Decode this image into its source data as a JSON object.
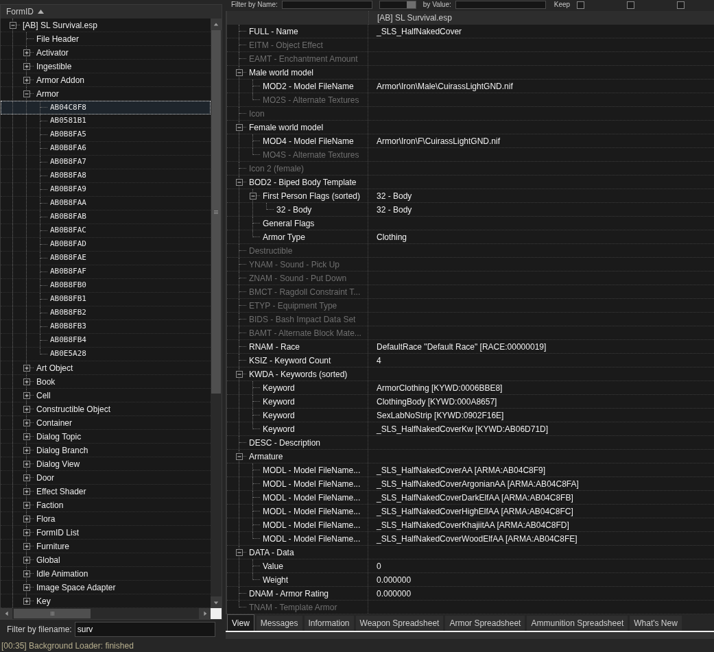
{
  "filter_bar": {
    "name_label": "Filter by Name:",
    "value_label": "by Value:",
    "keep_label": "Keep",
    "checkboxes": [
      {
        "checked": false
      },
      {
        "checked": false
      },
      {
        "checked": false
      }
    ]
  },
  "left_panel": {
    "column_header": "FormID",
    "sort_ascending": true,
    "tree": [
      {
        "label": "[AB] SL Survival.esp",
        "kind": "group",
        "expanded": true,
        "selected": false,
        "children": [
          {
            "label": "File Header",
            "kind": "group",
            "selected": false
          },
          {
            "label": "Activator",
            "kind": "group",
            "expanded": false,
            "selected": false
          },
          {
            "label": "Ingestible",
            "kind": "group",
            "expanded": false,
            "selected": false
          },
          {
            "label": "Armor Addon",
            "kind": "group",
            "expanded": false,
            "selected": false
          },
          {
            "label": "Armor",
            "kind": "group",
            "expanded": true,
            "selected": false,
            "children": [
              {
                "label": "AB04C8F8",
                "kind": "record",
                "selected": true
              },
              {
                "label": "AB0581B1",
                "kind": "record",
                "selected": false
              },
              {
                "label": "AB0B8FA5",
                "kind": "record",
                "selected": false
              },
              {
                "label": "AB0B8FA6",
                "kind": "record",
                "selected": false
              },
              {
                "label": "AB0B8FA7",
                "kind": "record",
                "selected": false
              },
              {
                "label": "AB0B8FA8",
                "kind": "record",
                "selected": false
              },
              {
                "label": "AB0B8FA9",
                "kind": "record",
                "selected": false
              },
              {
                "label": "AB0B8FAA",
                "kind": "record",
                "selected": false
              },
              {
                "label": "AB0B8FAB",
                "kind": "record",
                "selected": false
              },
              {
                "label": "AB0B8FAC",
                "kind": "record",
                "selected": false
              },
              {
                "label": "AB0B8FAD",
                "kind": "record",
                "selected": false
              },
              {
                "label": "AB0B8FAE",
                "kind": "record",
                "selected": false
              },
              {
                "label": "AB0B8FAF",
                "kind": "record",
                "selected": false
              },
              {
                "label": "AB0B8FB0",
                "kind": "record",
                "selected": false
              },
              {
                "label": "AB0B8FB1",
                "kind": "record",
                "selected": false
              },
              {
                "label": "AB0B8FB2",
                "kind": "record",
                "selected": false
              },
              {
                "label": "AB0B8FB3",
                "kind": "record",
                "selected": false
              },
              {
                "label": "AB0B8FB4",
                "kind": "record",
                "selected": false
              },
              {
                "label": "AB0E5A28",
                "kind": "record",
                "selected": false
              }
            ]
          },
          {
            "label": "Art Object",
            "kind": "group",
            "expanded": false,
            "selected": false
          },
          {
            "label": "Book",
            "kind": "group",
            "expanded": false,
            "selected": false
          },
          {
            "label": "Cell",
            "kind": "group",
            "expanded": false,
            "selected": false
          },
          {
            "label": "Constructible Object",
            "kind": "group",
            "expanded": false,
            "selected": false
          },
          {
            "label": "Container",
            "kind": "group",
            "expanded": false,
            "selected": false
          },
          {
            "label": "Dialog Topic",
            "kind": "group",
            "expanded": false,
            "selected": false
          },
          {
            "label": "Dialog Branch",
            "kind": "group",
            "expanded": false,
            "selected": false
          },
          {
            "label": "Dialog View",
            "kind": "group",
            "expanded": false,
            "selected": false
          },
          {
            "label": "Door",
            "kind": "group",
            "expanded": false,
            "selected": false
          },
          {
            "label": "Effect Shader",
            "kind": "group",
            "expanded": false,
            "selected": false
          },
          {
            "label": "Faction",
            "kind": "group",
            "expanded": false,
            "selected": false
          },
          {
            "label": "Flora",
            "kind": "group",
            "expanded": false,
            "selected": false
          },
          {
            "label": "FormID List",
            "kind": "group",
            "expanded": false,
            "selected": false
          },
          {
            "label": "Furniture",
            "kind": "group",
            "expanded": false,
            "selected": false
          },
          {
            "label": "Global",
            "kind": "group",
            "expanded": false,
            "selected": false
          },
          {
            "label": "Idle Animation",
            "kind": "group",
            "expanded": false,
            "selected": false
          },
          {
            "label": "Image Space Adapter",
            "kind": "group",
            "expanded": false,
            "selected": false
          },
          {
            "label": "Key",
            "kind": "group",
            "expanded": false,
            "selected": false
          }
        ]
      }
    ],
    "filename_filter": {
      "label": "Filter by filename:",
      "value": "surv"
    }
  },
  "record_view": {
    "columns": [
      "[AB] SL Survival.esp"
    ],
    "rows": [
      {
        "label": "FULL - Name",
        "value": "_SLS_HalfNakedCover",
        "present": true
      },
      {
        "label": "EITM - Object Effect",
        "present": false
      },
      {
        "label": "EAMT - Enchantment Amount",
        "present": false
      },
      {
        "label": "Male world model",
        "present": true,
        "expanded": true,
        "children": [
          {
            "label": "MOD2 - Model FileName",
            "value": "Armor\\Iron\\Male\\CuirassLightGND.nif",
            "present": true
          },
          {
            "label": "MO2S - Alternate Textures",
            "present": false
          }
        ]
      },
      {
        "label": "Icon",
        "present": false
      },
      {
        "label": "Female world model",
        "present": true,
        "expanded": true,
        "children": [
          {
            "label": "MOD4 - Model FileName",
            "value": "Armor\\Iron\\F\\CuirassLightGND.nif",
            "present": true
          },
          {
            "label": "MO4S - Alternate Textures",
            "present": false
          }
        ]
      },
      {
        "label": "Icon 2 (female)",
        "present": false
      },
      {
        "label": "BOD2 - Biped Body Template",
        "present": true,
        "expanded": true,
        "children": [
          {
            "label": "First Person Flags (sorted)",
            "value": "32 - Body",
            "present": true,
            "expanded": true,
            "children": [
              {
                "label": "32 - Body",
                "value": "32 - Body",
                "present": true
              }
            ]
          },
          {
            "label": "General Flags",
            "present": true
          },
          {
            "label": "Armor Type",
            "value": "Clothing",
            "present": true
          }
        ]
      },
      {
        "label": "Destructible",
        "present": false
      },
      {
        "label": "YNAM - Sound - Pick Up",
        "present": false
      },
      {
        "label": "ZNAM - Sound - Put Down",
        "present": false
      },
      {
        "label": "BMCT - Ragdoll Constraint T...",
        "present": false
      },
      {
        "label": "ETYP - Equipment Type",
        "present": false
      },
      {
        "label": "BIDS - Bash Impact Data Set",
        "present": false
      },
      {
        "label": "BAMT - Alternate Block Mate...",
        "present": false
      },
      {
        "label": "RNAM - Race",
        "value": "DefaultRace \"Default Race\" [RACE:00000019]",
        "present": true
      },
      {
        "label": "KSIZ - Keyword Count",
        "value": "4",
        "present": true
      },
      {
        "label": "KWDA - Keywords (sorted)",
        "present": true,
        "expanded": true,
        "children": [
          {
            "label": "Keyword",
            "value": "ArmorClothing [KYWD:0006BBE8]",
            "present": true
          },
          {
            "label": "Keyword",
            "value": "ClothingBody [KYWD:000A8657]",
            "present": true
          },
          {
            "label": "Keyword",
            "value": "SexLabNoStrip [KYWD:0902F16E]",
            "present": true
          },
          {
            "label": "Keyword",
            "value": "_SLS_HalfNakedCoverKw [KYWD:AB06D71D]",
            "present": true
          }
        ]
      },
      {
        "label": "DESC - Description",
        "present": true
      },
      {
        "label": "Armature",
        "present": true,
        "expanded": true,
        "children": [
          {
            "label": "MODL - Model FileName...",
            "value": "_SLS_HalfNakedCoverAA [ARMA:AB04C8F9]",
            "present": true
          },
          {
            "label": "MODL - Model FileName...",
            "value": "_SLS_HalfNakedCoverArgonianAA [ARMA:AB04C8FA]",
            "present": true
          },
          {
            "label": "MODL - Model FileName...",
            "value": "_SLS_HalfNakedCoverDarkElfAA [ARMA:AB04C8FB]",
            "present": true
          },
          {
            "label": "MODL - Model FileName...",
            "value": "_SLS_HalfNakedCoverHighElfAA [ARMA:AB04C8FC]",
            "present": true
          },
          {
            "label": "MODL - Model FileName...",
            "value": "_SLS_HalfNakedCoverKhajiitAA [ARMA:AB04C8FD]",
            "present": true
          },
          {
            "label": "MODL - Model FileName...",
            "value": "_SLS_HalfNakedCoverWoodElfAA [ARMA:AB04C8FE]",
            "present": true
          }
        ]
      },
      {
        "label": "DATA - Data",
        "present": true,
        "expanded": true,
        "children": [
          {
            "label": "Value",
            "value": "0",
            "present": true
          },
          {
            "label": "Weight",
            "value": "0.000000",
            "present": true
          }
        ]
      },
      {
        "label": "DNAM - Armor Rating",
        "value": "0.000000",
        "present": true
      },
      {
        "label": "TNAM - Template Armor",
        "present": false
      }
    ]
  },
  "tabs": [
    {
      "label": "View",
      "selected": true
    },
    {
      "label": "Messages",
      "selected": false
    },
    {
      "label": "Information",
      "selected": false
    },
    {
      "label": "Weapon Spreadsheet",
      "selected": false
    },
    {
      "label": "Armor Spreadsheet",
      "selected": false
    },
    {
      "label": "Ammunition Spreadsheet",
      "selected": false
    },
    {
      "label": "What's New",
      "selected": false
    }
  ],
  "status_bar": {
    "message": "[00:35] Background Loader: finished"
  }
}
